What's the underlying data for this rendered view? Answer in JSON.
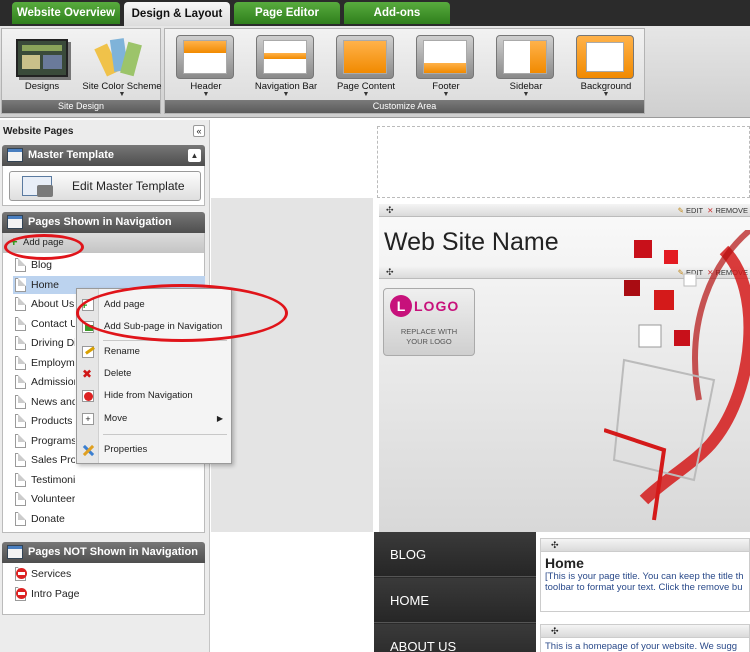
{
  "tabs": [
    {
      "label": "Website Overview",
      "active": false
    },
    {
      "label": "Design & Layout",
      "active": true
    },
    {
      "label": "Page Editor",
      "active": false
    },
    {
      "label": "Add-ons",
      "active": false
    }
  ],
  "ribbon": {
    "site_design": {
      "label": "Site Design",
      "buttons": [
        {
          "label": "Designs",
          "icon": "designs-icon",
          "has_menu": false
        },
        {
          "label": "Site Color Scheme",
          "icon": "color-scheme-icon",
          "has_menu": true
        }
      ]
    },
    "customize_area": {
      "label": "Customize Area",
      "buttons": [
        {
          "label": "Header",
          "icon": "layout-header-icon"
        },
        {
          "label": "Navigation Bar",
          "icon": "layout-navbar-icon"
        },
        {
          "label": "Page Content",
          "icon": "layout-content-icon"
        },
        {
          "label": "Footer",
          "icon": "layout-footer-icon"
        },
        {
          "label": "Sidebar",
          "icon": "layout-sidebar-icon"
        },
        {
          "label": "Background",
          "icon": "layout-background-icon"
        }
      ],
      "menu_arrow": "▼"
    }
  },
  "left_panel": {
    "title": "Website Pages",
    "collapse_glyph": "«",
    "master": {
      "title": "Master Template",
      "toggle_glyph": "▲",
      "edit_button": "Edit Master Template"
    },
    "shown": {
      "title": "Pages Shown in Navigation",
      "add_page": "Add page",
      "pages": [
        "Blog",
        "Home",
        "About Us",
        "Contact Us",
        "Driving Directions",
        "Employment",
        "Admissions",
        "News and Events",
        "Products",
        "Programs",
        "Sales Promotions",
        "Testimonials",
        "Volunteer",
        "Donate"
      ]
    },
    "not_shown": {
      "title": "Pages NOT Shown in Navigation",
      "pages": [
        "Services",
        "Intro Page"
      ]
    }
  },
  "context_menu": {
    "items": [
      {
        "label": "Add page",
        "icon": "add-page-icon"
      },
      {
        "label": "Add Sub-page in Navigation",
        "icon": "add-subpage-icon"
      },
      {
        "label": "Rename",
        "icon": "rename-icon"
      },
      {
        "label": "Delete",
        "icon": "delete-icon"
      },
      {
        "label": "Hide from Navigation",
        "icon": "hide-icon"
      },
      {
        "label": "Move",
        "icon": "move-icon",
        "submenu": "▶"
      },
      {
        "label": "Properties",
        "icon": "properties-icon"
      }
    ]
  },
  "canvas": {
    "module_actions": {
      "move": "✣",
      "edit": "EDIT",
      "remove": "REMOVE"
    },
    "site_name": "Web Site Name",
    "logo": {
      "mark": "L",
      "text": "LOGO",
      "replace_line1": "REPLACE WITH",
      "replace_line2": "YOUR LOGO"
    },
    "nav_items": [
      "BLOG",
      "HOME",
      "ABOUT US"
    ],
    "content": {
      "title": "Home",
      "text_line1": "[This is your page title. You can keep the title th",
      "text_line2": "toolbar to format your text. Click the remove bu",
      "text_line3": "This is a homepage of your website. We sugg"
    }
  },
  "colors": {
    "tab_green": "#3f9a2b",
    "annotation_red": "#e0141a",
    "accent_orange": "#f18a00",
    "logo_magenta": "#c7117b"
  }
}
